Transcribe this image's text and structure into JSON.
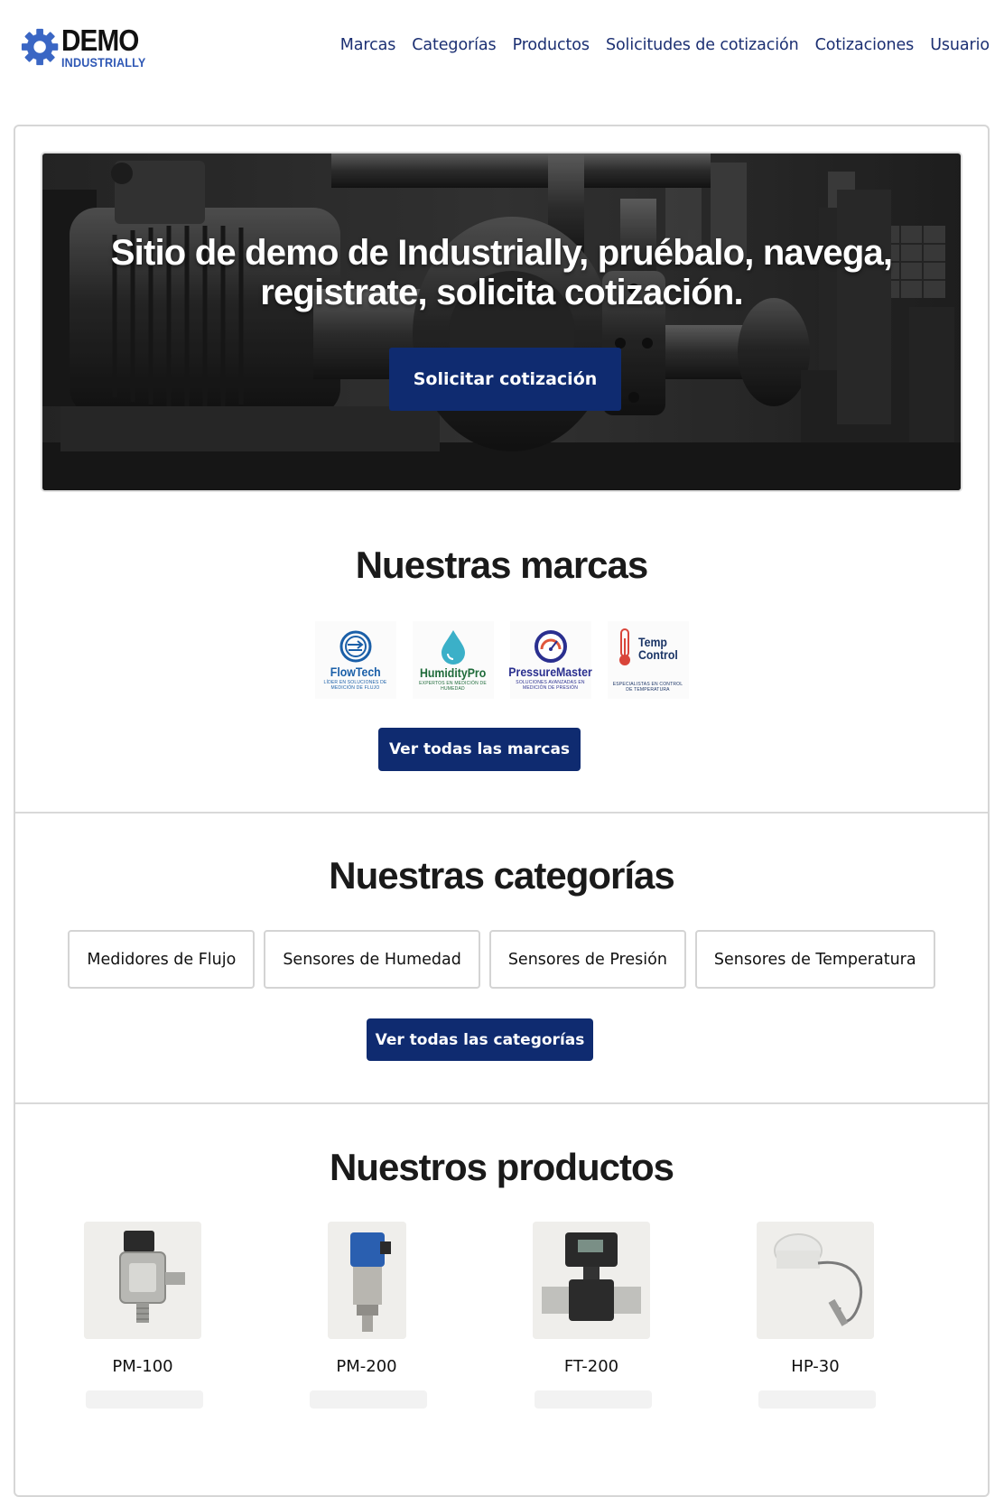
{
  "brand": {
    "logo_top": "DEMO",
    "logo_bottom": "INDUSTRIALLY"
  },
  "nav": {
    "items": [
      "Marcas",
      "Categorías",
      "Productos",
      "Solicitudes de cotización",
      "Cotizaciones",
      "Usuario"
    ]
  },
  "hero": {
    "title": "Sitio de demo de Industrially, pruébalo, navega, registrate, solicita cotización.",
    "cta": "Solicitar cotización"
  },
  "brands_section": {
    "title": "Nuestras marcas",
    "brands": [
      {
        "name": "FlowTech",
        "tagline": "LÍDER EN SOLUCIONES DE MEDICIÓN DE FLUJO",
        "color": "#1a5fa8",
        "icon": "flow-icon"
      },
      {
        "name": "HumidityPro",
        "tagline": "EXPERTOS EN MEDICIÓN DE HUMEDAD",
        "color": "#1f6b3a",
        "icon": "droplet-icon"
      },
      {
        "name": "PressureMaster",
        "tagline": "SOLUCIONES AVANZADAS EN MEDICIÓN DE PRESIÓN",
        "color": "#2a2f8f",
        "icon": "gauge-icon"
      },
      {
        "name": "Temp Control",
        "tagline": "ESPECIALISTAS EN CONTROL DE TEMPERATURA",
        "color": "#1b3566",
        "icon": "thermometer-icon"
      }
    ],
    "button": "Ver todas las marcas"
  },
  "categories_section": {
    "title": "Nuestras categorías",
    "items": [
      "Medidores de Flujo",
      "Sensores de Humedad",
      "Sensores de Presión",
      "Sensores de Temperatura"
    ],
    "button": "Ver todas las categorías"
  },
  "products_section": {
    "title": "Nuestros productos",
    "items": [
      {
        "name": "PM-100",
        "icon": "pressure-sensor-icon"
      },
      {
        "name": "PM-200",
        "icon": "pressure-transmitter-icon"
      },
      {
        "name": "FT-200",
        "icon": "flow-meter-icon"
      },
      {
        "name": "HP-30",
        "icon": "humidity-probe-icon"
      }
    ]
  },
  "colors": {
    "primary": "#0f2b70",
    "nav_link": "#1b2f72",
    "logo_blue": "#2f58b5"
  }
}
